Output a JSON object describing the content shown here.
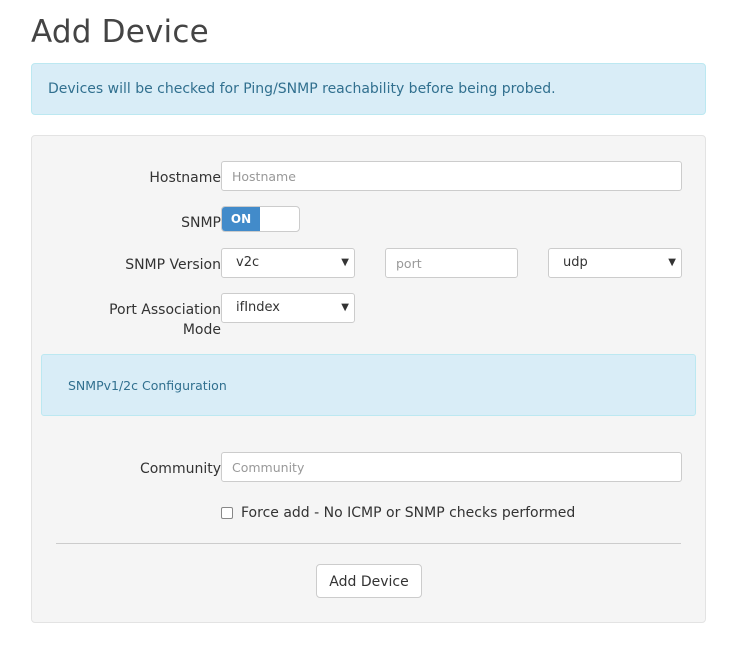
{
  "page": {
    "title": "Add Device"
  },
  "alert": {
    "text": "Devices will be checked for Ping/SNMP reachability before being probed."
  },
  "form": {
    "hostname": {
      "label": "Hostname",
      "placeholder": "Hostname",
      "value": ""
    },
    "snmp": {
      "label": "SNMP",
      "toggle_label": "ON",
      "enabled": true
    },
    "snmp_version": {
      "label": "SNMP Version",
      "version_selected": "v2c",
      "port_placeholder": "port",
      "transport_selected": "udp"
    },
    "port_association": {
      "label_line1": "Port Association",
      "label_line2": "Mode",
      "selected": "ifIndex"
    },
    "snmp_config": {
      "title": "SNMPv1/2c Configuration"
    },
    "community": {
      "label": "Community",
      "placeholder": "Community",
      "value": ""
    },
    "force_add": {
      "label": "Force add - No ICMP or SNMP checks performed",
      "checked": false
    },
    "submit_label": "Add Device"
  },
  "colors": {
    "accent": "#428bca",
    "info_bg": "#d9edf7",
    "info_text": "#31708f",
    "panel_bg": "#f5f5f5"
  },
  "icons": {
    "select_arrow": "caret-down-icon"
  }
}
